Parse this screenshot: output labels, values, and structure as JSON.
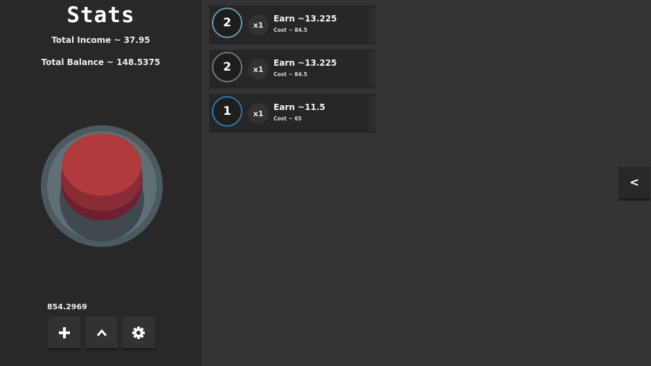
{
  "stats": {
    "title": "Stats",
    "total_income": "Total Income ~ 37.95",
    "total_balance": "Total Balance ~ 148.5375"
  },
  "big_button": {
    "icon": "big-red-button",
    "color": "#b03a3c"
  },
  "counter": "854.2969",
  "toolbar": [
    {
      "icon": "plus-icon"
    },
    {
      "icon": "chevron-up-icon"
    },
    {
      "icon": "gear-icon"
    }
  ],
  "upgrades": [
    {
      "level": "2",
      "multiplier": "x1",
      "earn": "Earn ~13.225",
      "cost": "Cost ~ 84.5",
      "ring_color": "#6a9cb0"
    },
    {
      "level": "2",
      "multiplier": "x1",
      "earn": "Earn ~13.225",
      "cost": "Cost ~ 84.5",
      "ring_color": "#707a7c"
    },
    {
      "level": "1",
      "multiplier": "x1",
      "earn": "Earn ~11.5",
      "cost": "Cost ~ 65",
      "ring_color": "#2f7ab0"
    }
  ],
  "collapse_button": {
    "label": "<",
    "icon": "chevron-left-icon"
  }
}
